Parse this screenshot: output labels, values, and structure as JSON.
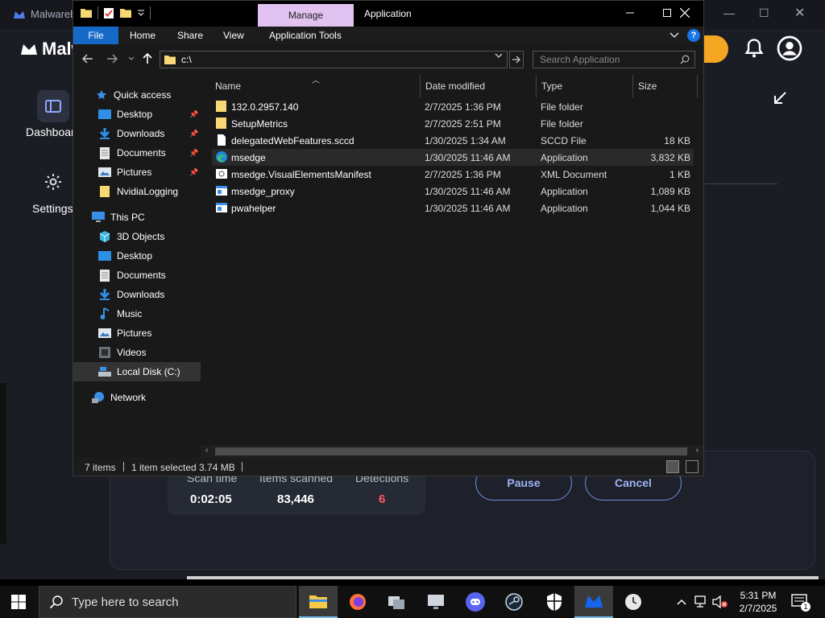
{
  "background_app": {
    "title": "Malwareb",
    "logo_text": "Malwa",
    "nav_dashboard": "Dashboar",
    "nav_settings": "Settings",
    "stats_headers": [
      "Scan time",
      "Items scanned",
      "Detections"
    ],
    "stats_values": [
      "0:02:05",
      "83,446",
      "6"
    ],
    "pause_label": "Pause",
    "cancel_label": "Cancel",
    "detections_color": "#ff5a67",
    "accent_color": "#f5a623"
  },
  "explorer": {
    "title": "Application",
    "manage_tab": "Manage",
    "ribbon_tabs": [
      "File",
      "Home",
      "Share",
      "View",
      "Application Tools"
    ],
    "address": "c:\\",
    "search_placeholder": "Search Application",
    "nav": {
      "quick_access": "Quick access",
      "quick_items": [
        "Desktop",
        "Downloads",
        "Documents",
        "Pictures",
        "NvidiaLogging"
      ],
      "this_pc": "This PC",
      "pc_items": [
        "3D Objects",
        "Desktop",
        "Documents",
        "Downloads",
        "Music",
        "Pictures",
        "Videos",
        "Local Disk (C:)"
      ],
      "network": "Network"
    },
    "columns": [
      "Name",
      "Date modified",
      "Type",
      "Size"
    ],
    "files": [
      {
        "name": "132.0.2957.140",
        "date": "2/7/2025 1:36 PM",
        "type": "File folder",
        "size": "",
        "icon": "folder-icon"
      },
      {
        "name": "SetupMetrics",
        "date": "2/7/2025 2:51 PM",
        "type": "File folder",
        "size": "",
        "icon": "folder-icon"
      },
      {
        "name": "delegatedWebFeatures.sccd",
        "date": "1/30/2025 1:34 AM",
        "type": "SCCD File",
        "size": "18 KB",
        "icon": "file-icon"
      },
      {
        "name": "msedge",
        "date": "1/30/2025 11:46 AM",
        "type": "Application",
        "size": "3,832 KB",
        "icon": "edge-icon"
      },
      {
        "name": "msedge.VisualElementsManifest",
        "date": "2/7/2025 1:36 PM",
        "type": "XML Document",
        "size": "1 KB",
        "icon": "xml-icon"
      },
      {
        "name": "msedge_proxy",
        "date": "1/30/2025 11:46 AM",
        "type": "Application",
        "size": "1,089 KB",
        "icon": "app-icon"
      },
      {
        "name": "pwahelper",
        "date": "1/30/2025 11:46 AM",
        "type": "Application",
        "size": "1,044 KB",
        "icon": "app-icon"
      }
    ],
    "status": {
      "items": "7 items",
      "selected": "1 item selected  3.74 MB"
    }
  },
  "taskbar": {
    "search_placeholder": "Type here to search",
    "time": "5:31 PM",
    "date": "2/7/2025",
    "notification_count": "1"
  }
}
